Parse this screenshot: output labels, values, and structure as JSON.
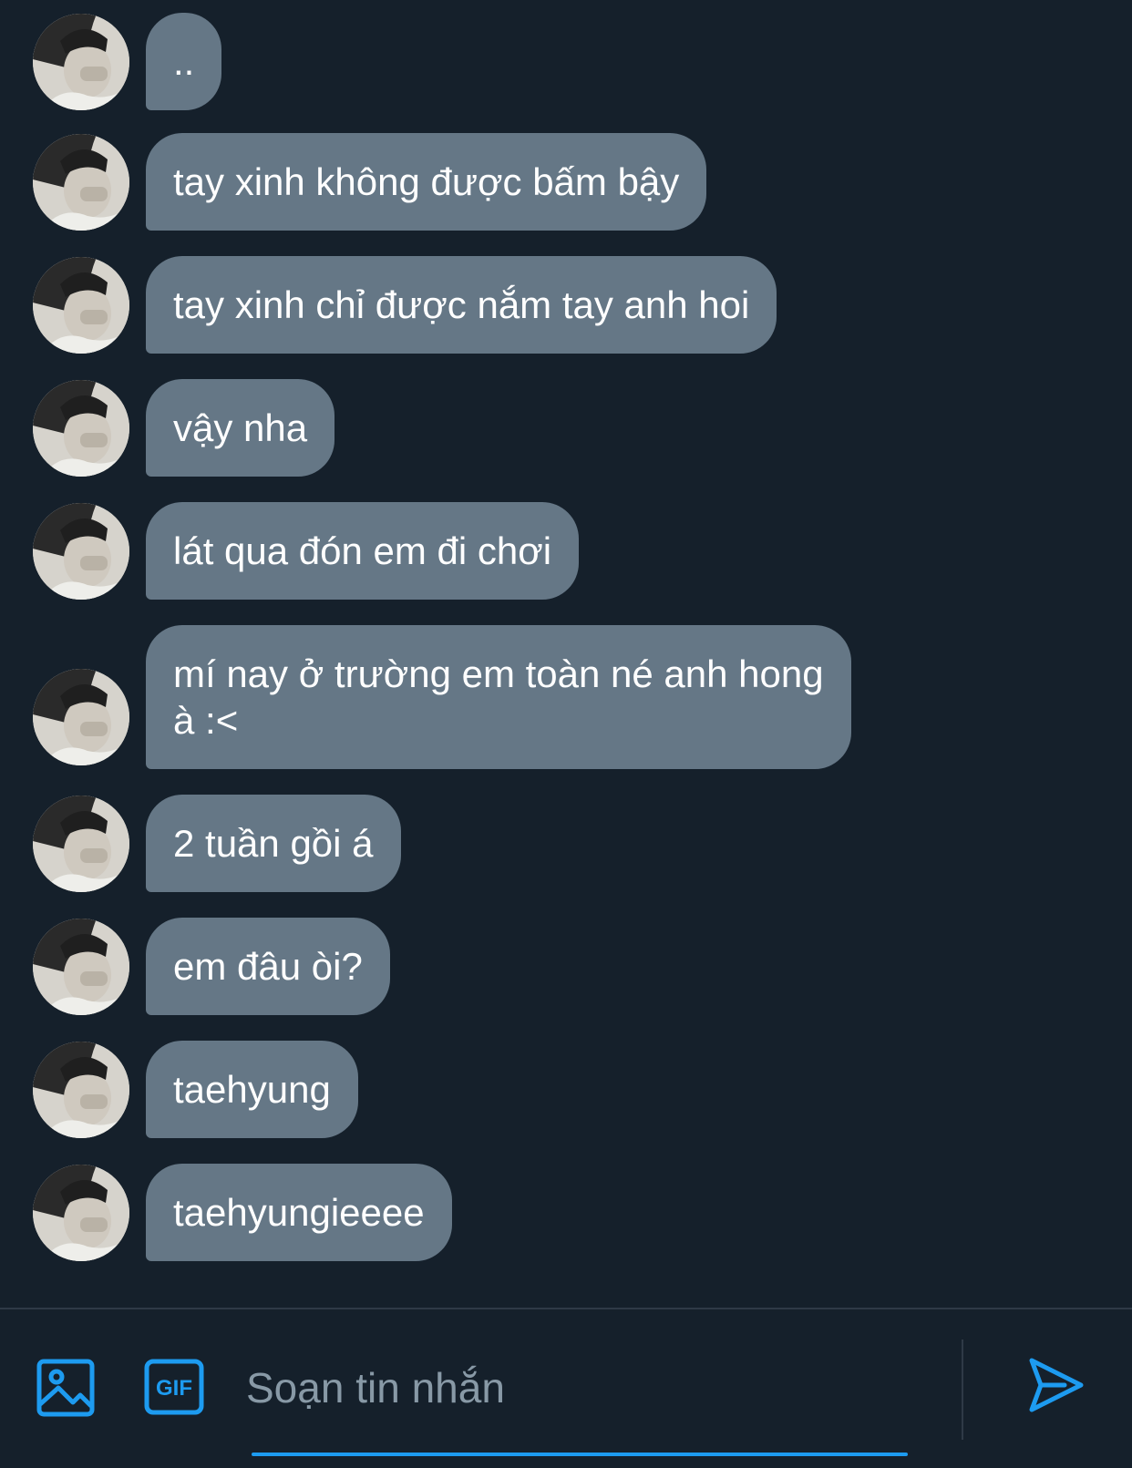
{
  "conversation": {
    "avatar_icon": "user-avatar-photo",
    "messages": [
      {
        "text": ".."
      },
      {
        "text": "tay xinh không được bấm bậy"
      },
      {
        "text": "tay xinh chỉ được nắm tay anh hoi"
      },
      {
        "text": "vậy nha"
      },
      {
        "text": "lát qua đón em đi chơi"
      },
      {
        "text": "mí nay ở trường em toàn né anh hong\nà :<"
      },
      {
        "text": "2 tuần gồi á"
      },
      {
        "text": "em đâu òi?"
      },
      {
        "text": "taehyung"
      },
      {
        "text": "taehyungieeee"
      }
    ]
  },
  "composer": {
    "image_icon": "image-icon",
    "gif_icon": "gif-icon",
    "gif_label": "GIF",
    "placeholder": "Soạn tin nhắn",
    "send_icon": "send-icon"
  },
  "colors": {
    "background": "#15202b",
    "bubble": "#657786",
    "accent": "#1d9bf0",
    "placeholder": "#8899a6"
  }
}
